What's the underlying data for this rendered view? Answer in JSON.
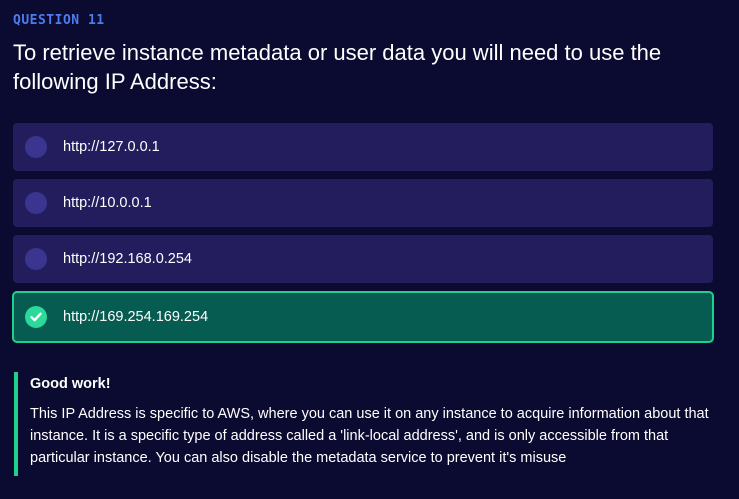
{
  "question": {
    "label": "QUESTION 11",
    "text": "To retrieve instance metadata or user data you will need to use the following IP Address:"
  },
  "options": [
    {
      "text": "http://127.0.0.1",
      "state": "unselected"
    },
    {
      "text": "http://10.0.0.1",
      "state": "unselected"
    },
    {
      "text": "http://192.168.0.254",
      "state": "unselected"
    },
    {
      "text": "http://169.254.169.254",
      "state": "correct"
    }
  ],
  "feedback": {
    "title": "Good work!",
    "body": "This IP Address is specific to AWS, where you can use it on any instance to acquire information about that instance. It is a specific type of address called a 'link-local address', and is only accessible from that particular instance. You can also disable the metadata service to prevent it's misuse"
  },
  "colors": {
    "background": "#0b0a30",
    "accent": "#4d7bf0",
    "option_bg": "#231d5e",
    "correct_bg": "#065c50",
    "correct_border": "#1fd08c"
  },
  "icons": {
    "correct_option": "check-circle-icon",
    "unselected_option": "radio-empty-icon"
  }
}
